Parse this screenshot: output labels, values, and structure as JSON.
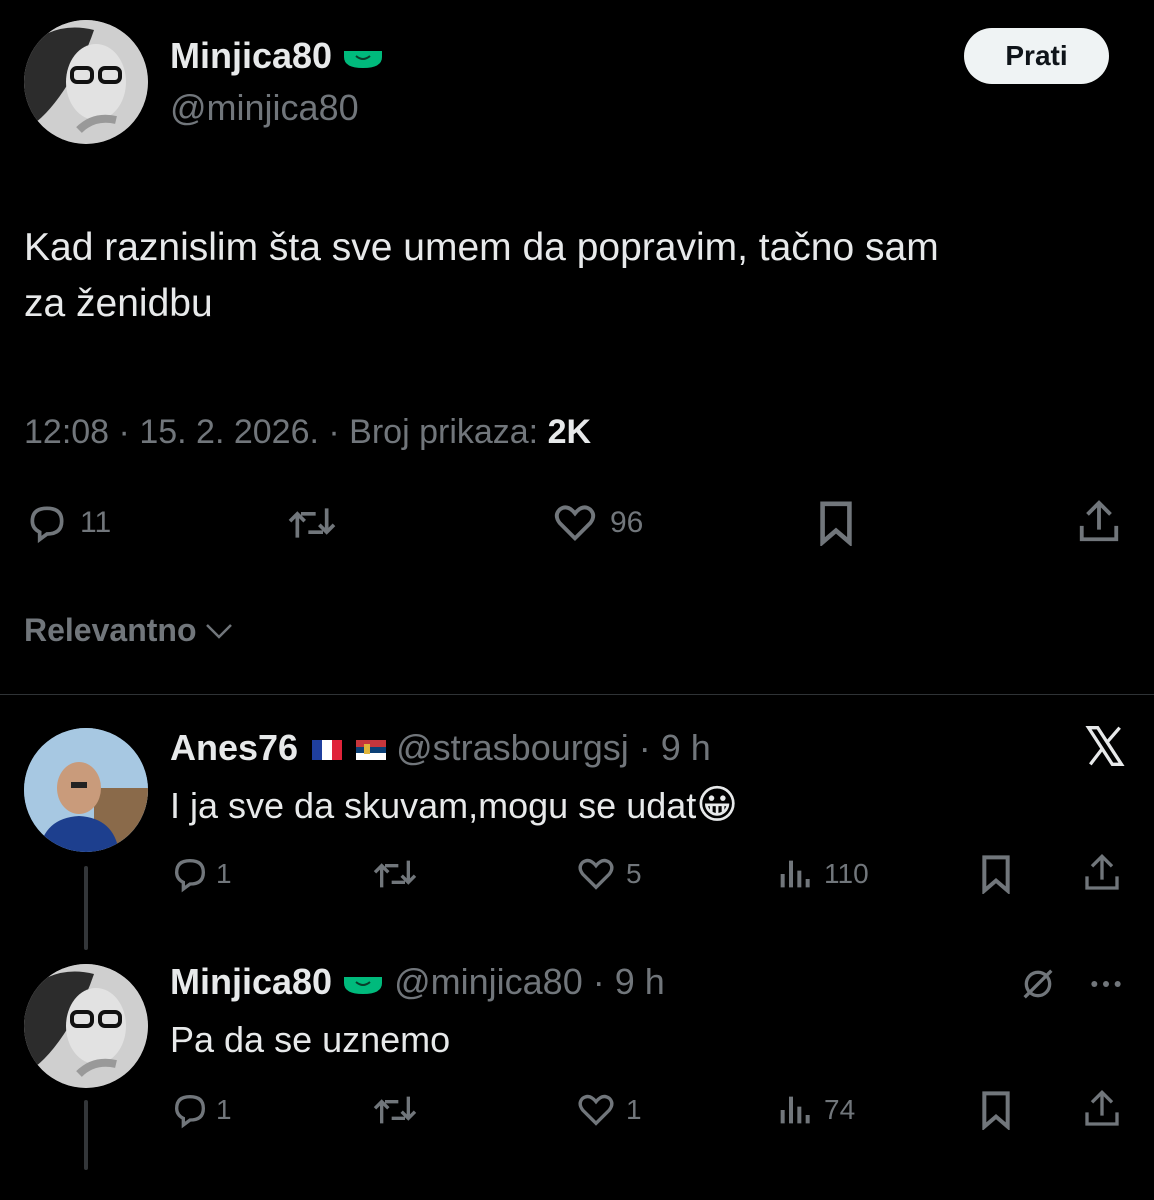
{
  "main_post": {
    "author_name": "Minjica80",
    "author_handle": "@minjica80",
    "follow_label": "Prati",
    "text_line1": "Kad raznislim šta sve umem da popravim, tačno sam",
    "text_line2": "za ženidbu",
    "time": "12:08",
    "date": "15. 2. 2026.",
    "views_label": "Broj prikaza:",
    "views_count": "2K",
    "replies": "11",
    "likes": "96"
  },
  "sort": {
    "label": "Relevantno"
  },
  "replies": [
    {
      "author_name": "Anes76",
      "author_handle": "@strasbourgsj",
      "time": "9 h",
      "text": "I ja sve da skuvam,mogu se udat",
      "emoji": "😀",
      "reply_count": "1",
      "like_count": "5",
      "view_count": "110"
    },
    {
      "author_name": "Minjica80",
      "author_handle": "@minjica80",
      "time": "9 h",
      "text": "Pa da se uznemo",
      "reply_count": "1",
      "like_count": "1",
      "view_count": "74"
    }
  ],
  "icons": {
    "reply": "speech-bubble-icon",
    "repost": "repost-icon",
    "like": "heart-icon",
    "bookmark": "bookmark-icon",
    "share": "share-icon",
    "views": "bar-chart-icon",
    "more": "more-icon",
    "grok": "grok-icon",
    "badge": "green-badge-icon"
  },
  "colors": {
    "background": "#000000",
    "text": "#e7e9ea",
    "muted": "#71767b",
    "badge": "#00ba7c"
  }
}
